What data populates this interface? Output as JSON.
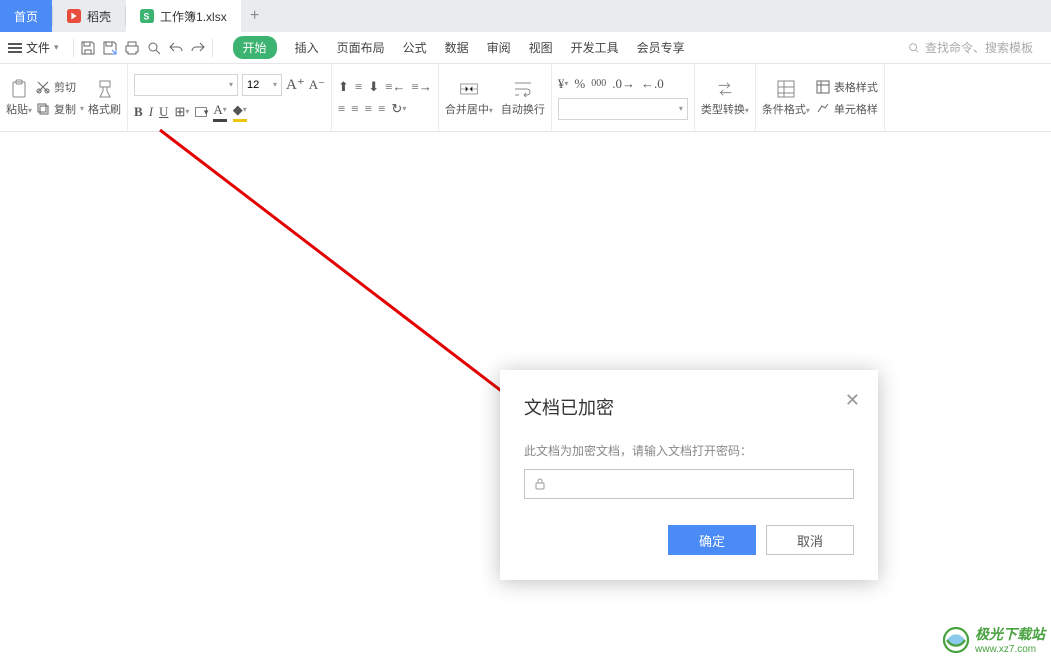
{
  "tabs": {
    "home": "首页",
    "daoke": "稻壳",
    "file": "工作簿1.xlsx"
  },
  "menubar": {
    "file": "文件",
    "items": [
      "开始",
      "插入",
      "页面布局",
      "公式",
      "数据",
      "审阅",
      "视图",
      "开发工具",
      "会员专享"
    ],
    "search_ph": "查找命令、搜索模板"
  },
  "clipboard": {
    "paste": "粘贴",
    "cut": "剪切",
    "copy": "复制",
    "format": "格式刷"
  },
  "font": {
    "size": "12"
  },
  "merge": {
    "merge": "合并居中",
    "wrap": "自动换行"
  },
  "convert": {
    "label": "类型转换"
  },
  "cond": {
    "label": "条件格式",
    "style": "表格样式",
    "cell": "单元格样"
  },
  "dialog": {
    "title": "文档已加密",
    "msg": "此文档为加密文档，请输入文档打开密码：",
    "ok": "确定",
    "cancel": "取消"
  },
  "watermark": {
    "t1": "极光下载站",
    "t2": "www.xz7.com"
  }
}
